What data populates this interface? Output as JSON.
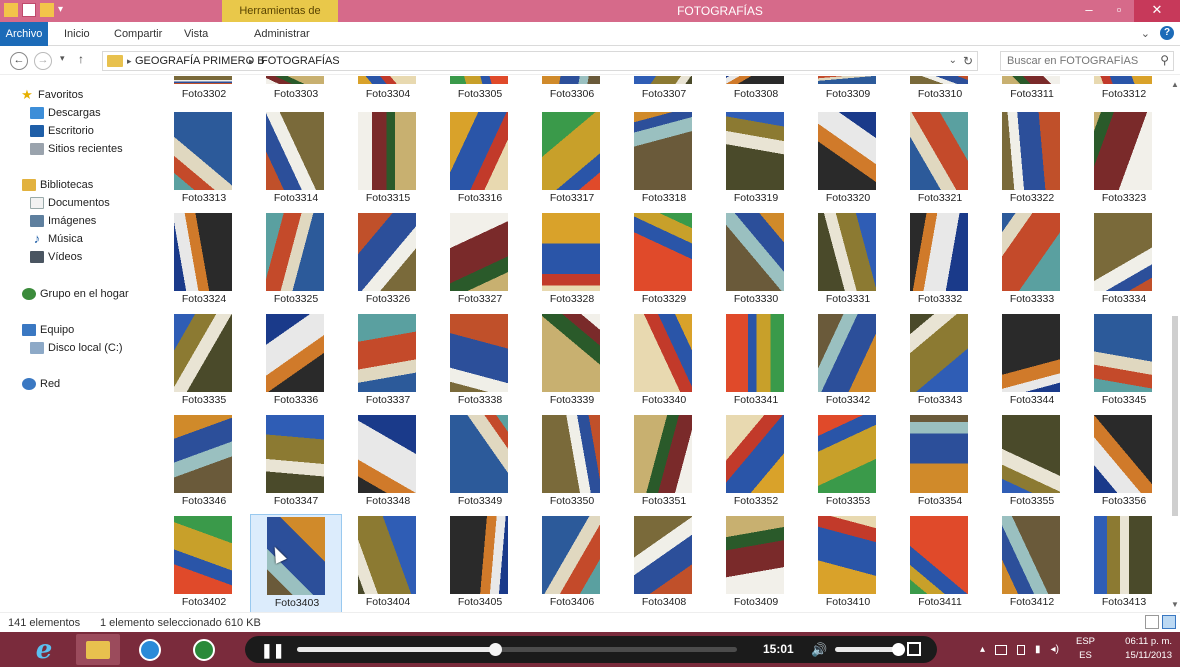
{
  "window": {
    "title": "FOTOGRAFÍAS",
    "contextual_tab": "Herramientas de imagen",
    "min": "–",
    "max": "▫",
    "close": "✕"
  },
  "ribbon": {
    "tabs": [
      "Archivo",
      "Inicio",
      "Compartir",
      "Vista",
      "Administrar"
    ],
    "expand": "⌄",
    "help": "?"
  },
  "address": {
    "back": "←",
    "forward": "→",
    "recent": "▾",
    "up": "↑",
    "crumbs": [
      "GEOGRAFÍA PRIMERO B",
      "FOTOGRAFÍAS"
    ],
    "sep": "▸",
    "dropdown": "⌄",
    "refresh": "↻",
    "search_placeholder": "Buscar en FOTOGRAFÍAS",
    "search_icon": "⚲"
  },
  "nav": {
    "favorites": {
      "label": "Favoritos",
      "icon": "star-icon",
      "items": [
        {
          "label": "Descargas",
          "icon": "downloads-icon"
        },
        {
          "label": "Escritorio",
          "icon": "desktop-icon"
        },
        {
          "label": "Sitios recientes",
          "icon": "recent-places-icon"
        }
      ]
    },
    "libraries": {
      "label": "Bibliotecas",
      "icon": "libraries-icon",
      "items": [
        {
          "label": "Documentos",
          "icon": "documents-icon"
        },
        {
          "label": "Imágenes",
          "icon": "pictures-icon"
        },
        {
          "label": "Música",
          "icon": "music-icon"
        },
        {
          "label": "Vídeos",
          "icon": "videos-icon"
        }
      ]
    },
    "homegroup": {
      "label": "Grupo en el hogar",
      "icon": "homegroup-icon"
    },
    "computer": {
      "label": "Equipo",
      "icon": "computer-icon",
      "items": [
        {
          "label": "Disco local (C:)",
          "icon": "local-disk-icon"
        }
      ]
    },
    "network": {
      "label": "Red",
      "icon": "network-icon"
    }
  },
  "files": {
    "rows": [
      [
        "Foto3302",
        "Foto3303",
        "Foto3304",
        "Foto3305",
        "Foto3306",
        "Foto3307",
        "Foto3308",
        "Foto3309",
        "Foto3310",
        "Foto3311",
        "Foto3312"
      ],
      [
        "Foto3313",
        "Foto3314",
        "Foto3315",
        "Foto3316",
        "Foto3317",
        "Foto3318",
        "Foto3319",
        "Foto3320",
        "Foto3321",
        "Foto3322",
        "Foto3323"
      ],
      [
        "Foto3324",
        "Foto3325",
        "Foto3326",
        "Foto3327",
        "Foto3328",
        "Foto3329",
        "Foto3330",
        "Foto3331",
        "Foto3332",
        "Foto3333",
        "Foto3334"
      ],
      [
        "Foto3335",
        "Foto3336",
        "Foto3337",
        "Foto3338",
        "Foto3339",
        "Foto3340",
        "Foto3341",
        "Foto3342",
        "Foto3343",
        "Foto3344",
        "Foto3345"
      ],
      [
        "Foto3346",
        "Foto3347",
        "Foto3348",
        "Foto3349",
        "Foto3350",
        "Foto3351",
        "Foto3352",
        "Foto3353",
        "Foto3354",
        "Foto3355",
        "Foto3356"
      ],
      [
        "Foto3402",
        "Foto3403",
        "Foto3404",
        "Foto3405",
        "Foto3406",
        "Foto3408",
        "Foto3409",
        "Foto3410",
        "Foto3411",
        "Foto3412",
        "Foto3413"
      ]
    ],
    "selected": "Foto3403",
    "thumb_palettes": [
      [
        "#c0502a",
        "#2c4f9a",
        "#f0efe8",
        "#7a6a3a"
      ],
      [
        "#2f5db5",
        "#8c7a32",
        "#e9e4d4",
        "#4a4a2a"
      ],
      [
        "#d9a22a",
        "#2a55a8",
        "#c23a2a",
        "#e8d9b0"
      ],
      [
        "#5aa0a0",
        "#c44a2a",
        "#e0d8c0",
        "#2c5a9a"
      ],
      [
        "#d08a2a",
        "#2c4f9a",
        "#9ac0c0",
        "#6a5a3a"
      ],
      [
        "#f2f0ea",
        "#7a2a2a",
        "#2a5a2a",
        "#c8b070"
      ],
      [
        "#1a3a8a",
        "#e8e8e8",
        "#d07a2a",
        "#2a2a2a"
      ],
      [
        "#3a9a4a",
        "#c8a02a",
        "#2a55a8",
        "#e04a2a"
      ]
    ]
  },
  "status": {
    "count": "141 elementos",
    "selection": "1 elemento seleccionado  610 KB"
  },
  "taskbar": {
    "apps": [
      {
        "name": "internet-explorer",
        "glyph": "e"
      },
      {
        "name": "file-explorer",
        "glyph": ""
      },
      {
        "name": "media-center",
        "glyph": ""
      },
      {
        "name": "media-player",
        "glyph": ""
      }
    ],
    "player": {
      "pause": "❚❚",
      "time": "15:01",
      "progress": 0.45,
      "volume_icon": "🔊",
      "volume": 0.9
    },
    "lang_top": "ESP",
    "lang_bottom": "ES",
    "time": "06:11 p. m.",
    "date": "15/11/2013",
    "tray_up": "▴"
  }
}
